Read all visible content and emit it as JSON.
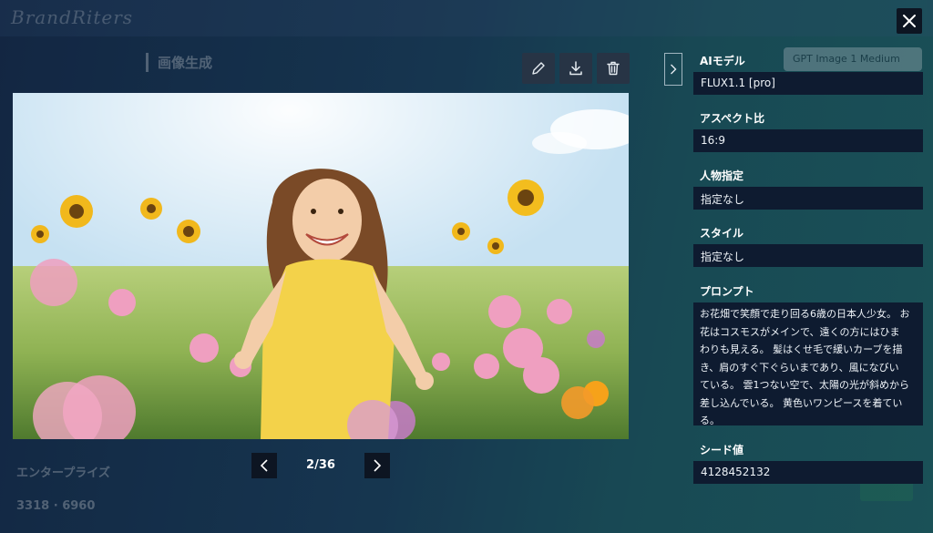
{
  "background": {
    "logo": "BrandRiters",
    "page_title": "画像生成",
    "side_labels": [
      "エンタープライズ",
      "3318",
      "6960"
    ],
    "model_select": "GPT Image 1 Medium"
  },
  "toolbar": {
    "edit_icon": "pencil-icon",
    "download_icon": "download-icon",
    "delete_icon": "trash-icon",
    "close_icon": "close-icon"
  },
  "pagination": {
    "current": "2/36"
  },
  "details": {
    "model_label": "AIモデル",
    "model_value": "FLUX1.1 [pro]",
    "aspect_label": "アスペクト比",
    "aspect_value": "16:9",
    "person_label": "人物指定",
    "person_value": "指定なし",
    "style_label": "スタイル",
    "style_value": "指定なし",
    "prompt_label": "プロンプト",
    "prompt_lines": [
      "お花畑で笑顔で走り回る6歳の日本人少女。 お",
      "花はコスモスがメインで、遠くの方にはひま",
      "わりも見える。 髪はくせ毛で緩いカーブを描",
      "き、肩のすぐ下ぐらいまであり、風になびい",
      "ている。 雲1つない空で、太陽の光が斜めから",
      "差し込んでいる。 黄色いワンピースを着てい",
      "る。"
    ],
    "seed_label": "シード値",
    "seed_value": "4128452132"
  },
  "colors": {
    "field_bg": "#0e1b30",
    "button_bg": "#0d1522"
  }
}
